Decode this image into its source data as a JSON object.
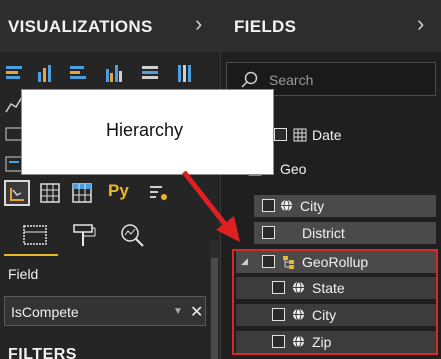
{
  "visualizations_pane": {
    "title": "VISUALIZATIONS",
    "collapse_icon": "chevron-right-icon",
    "python_visual_label": "Py",
    "field_label": "Field",
    "field_value": "IsCompete",
    "filters_label": "FILTERS"
  },
  "fields_pane": {
    "title": "FIELDS",
    "collapse_icon": "chevron-right-icon",
    "search_placeholder": "Search",
    "tables": [
      {
        "name": "Date"
      },
      {
        "name": "Geo"
      }
    ],
    "geo_fields": [
      {
        "name": "City"
      },
      {
        "name": "District"
      }
    ],
    "hierarchy": {
      "name": "GeoRollup",
      "levels": [
        "State",
        "City",
        "Zip"
      ]
    }
  },
  "tooltip": {
    "text": "Hierarchy"
  },
  "colors": {
    "accent_red": "#d42a2a",
    "pane_bg": "#252526",
    "highlight_row": "#4a4a4a"
  }
}
